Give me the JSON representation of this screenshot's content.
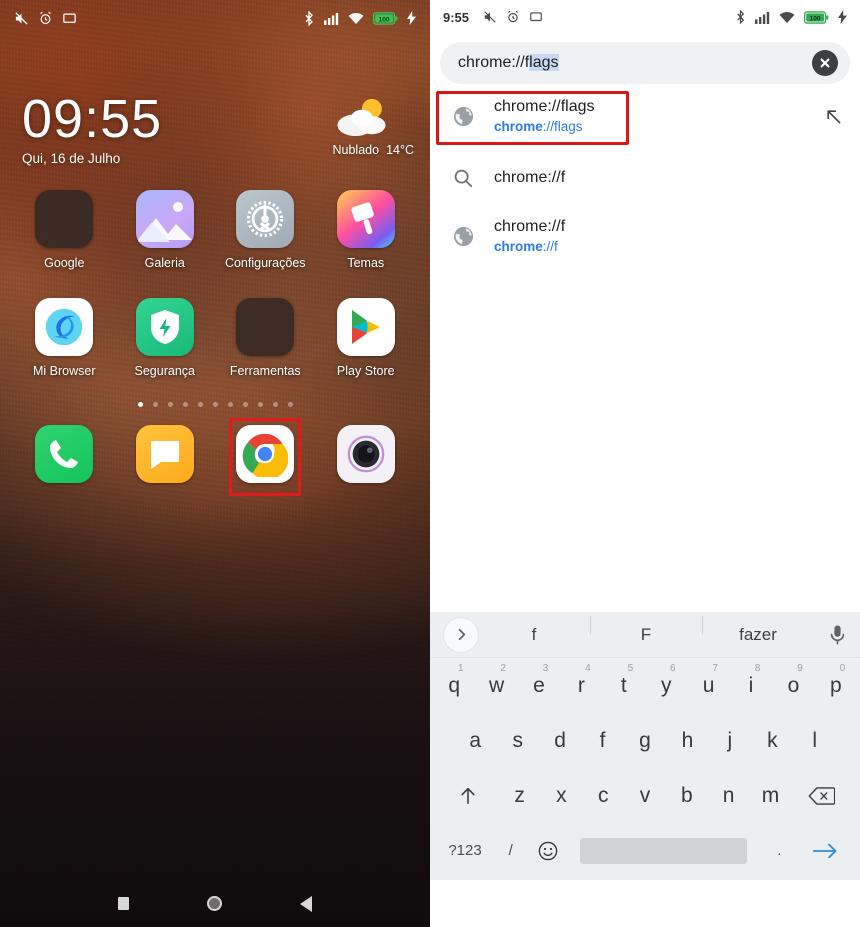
{
  "left_screen": {
    "status_bar": {
      "icons_left": [
        "mute-icon",
        "alarm-icon",
        "cast-icon"
      ],
      "icons_right": [
        "bluetooth-icon",
        "cellular-signal-icon",
        "wifi-icon",
        "battery-icon",
        "charging-icon"
      ],
      "battery_level": "100"
    },
    "clock_widget": {
      "time": "09:55",
      "date": "Qui, 16 de Julho",
      "weather_condition": "Nublado",
      "weather_temp": "14°C",
      "weather_icon": "partly-cloudy-icon"
    },
    "app_rows": [
      [
        {
          "label": "Google",
          "icon": "google-folder-icon"
        },
        {
          "label": "Galeria",
          "icon": "gallery-icon"
        },
        {
          "label": "Configurações",
          "icon": "settings-gear-icon"
        },
        {
          "label": "Temas",
          "icon": "themes-icon"
        }
      ],
      [
        {
          "label": "Mi Browser",
          "icon": "mi-browser-icon"
        },
        {
          "label": "Segurança",
          "icon": "security-shield-icon"
        },
        {
          "label": "Ferramentas",
          "icon": "tools-folder-icon"
        },
        {
          "label": "Play Store",
          "icon": "play-store-icon"
        }
      ]
    ],
    "page_indicator": {
      "count": 11,
      "active_index": 0
    },
    "dock": [
      {
        "label": "Telefone",
        "icon": "phone-icon",
        "highlighted": false
      },
      {
        "label": "Mensagens",
        "icon": "messages-icon",
        "highlighted": false
      },
      {
        "label": "Chrome",
        "icon": "chrome-icon",
        "highlighted": true
      },
      {
        "label": "Câmera",
        "icon": "camera-icon",
        "highlighted": false
      }
    ],
    "nav_bar": [
      "recents-square-icon",
      "home-circle-icon",
      "back-triangle-icon"
    ]
  },
  "right_screen": {
    "status_bar": {
      "time": "9:55",
      "icons_left": [
        "mute-icon",
        "alarm-icon",
        "cast-icon"
      ],
      "icons_right": [
        "bluetooth-icon",
        "cellular-signal-icon",
        "wifi-icon",
        "battery-icon",
        "charging-icon"
      ],
      "battery_level": "100"
    },
    "omnibox": {
      "typed_text": "chrome://f",
      "autocomplete_text": "lags",
      "full_value": "chrome://flags",
      "clear_icon": "clear-circle-icon"
    },
    "suggestions": [
      {
        "icon": "globe-icon",
        "title": "chrome://flags",
        "url_bold": "chrome",
        "url_rest": "://flags",
        "trailing_icon": "fill-arrow-icon",
        "highlighted": true
      },
      {
        "icon": "search-icon",
        "title": "chrome://f",
        "url_bold": "",
        "url_rest": "",
        "trailing_icon": "",
        "highlighted": false
      },
      {
        "icon": "globe-icon",
        "title": "chrome://f",
        "url_bold": "chrome",
        "url_rest": "://f",
        "trailing_icon": "",
        "highlighted": false
      }
    ],
    "keyboard": {
      "suggestion_strip": {
        "expand_icon": "chevron-right-icon",
        "items": [
          "f",
          "F",
          "fazer"
        ],
        "mic_icon": "microphone-icon"
      },
      "row1": [
        {
          "k": "q",
          "n": "1"
        },
        {
          "k": "w",
          "n": "2"
        },
        {
          "k": "e",
          "n": "3"
        },
        {
          "k": "r",
          "n": "4"
        },
        {
          "k": "t",
          "n": "5"
        },
        {
          "k": "y",
          "n": "6"
        },
        {
          "k": "u",
          "n": "7"
        },
        {
          "k": "i",
          "n": "8"
        },
        {
          "k": "o",
          "n": "9"
        },
        {
          "k": "p",
          "n": "0"
        }
      ],
      "row2": [
        "a",
        "s",
        "d",
        "f",
        "g",
        "h",
        "j",
        "k",
        "l"
      ],
      "row3": {
        "shift_icon": "shift-arrow-icon",
        "keys": [
          "z",
          "x",
          "c",
          "v",
          "b",
          "n",
          "m"
        ],
        "backspace_icon": "backspace-icon"
      },
      "row4": {
        "symbols_label": "?123",
        "slash_label": "/",
        "emoji_icon": "emoji-icon",
        "space_label": "",
        "period_label": ".",
        "enter_icon": "go-arrow-icon"
      }
    },
    "nav_bar": [
      "recents-square-icon",
      "home-circle-icon",
      "back-triangle-icon"
    ]
  },
  "colors": {
    "highlight_red": "#d81818",
    "link_blue": "#2b7de0",
    "selection_blue": "#c7d8f5",
    "keyboard_bg": "#eceff1",
    "omnibox_bg": "#eff1f3",
    "battery_green": "#34a853"
  }
}
